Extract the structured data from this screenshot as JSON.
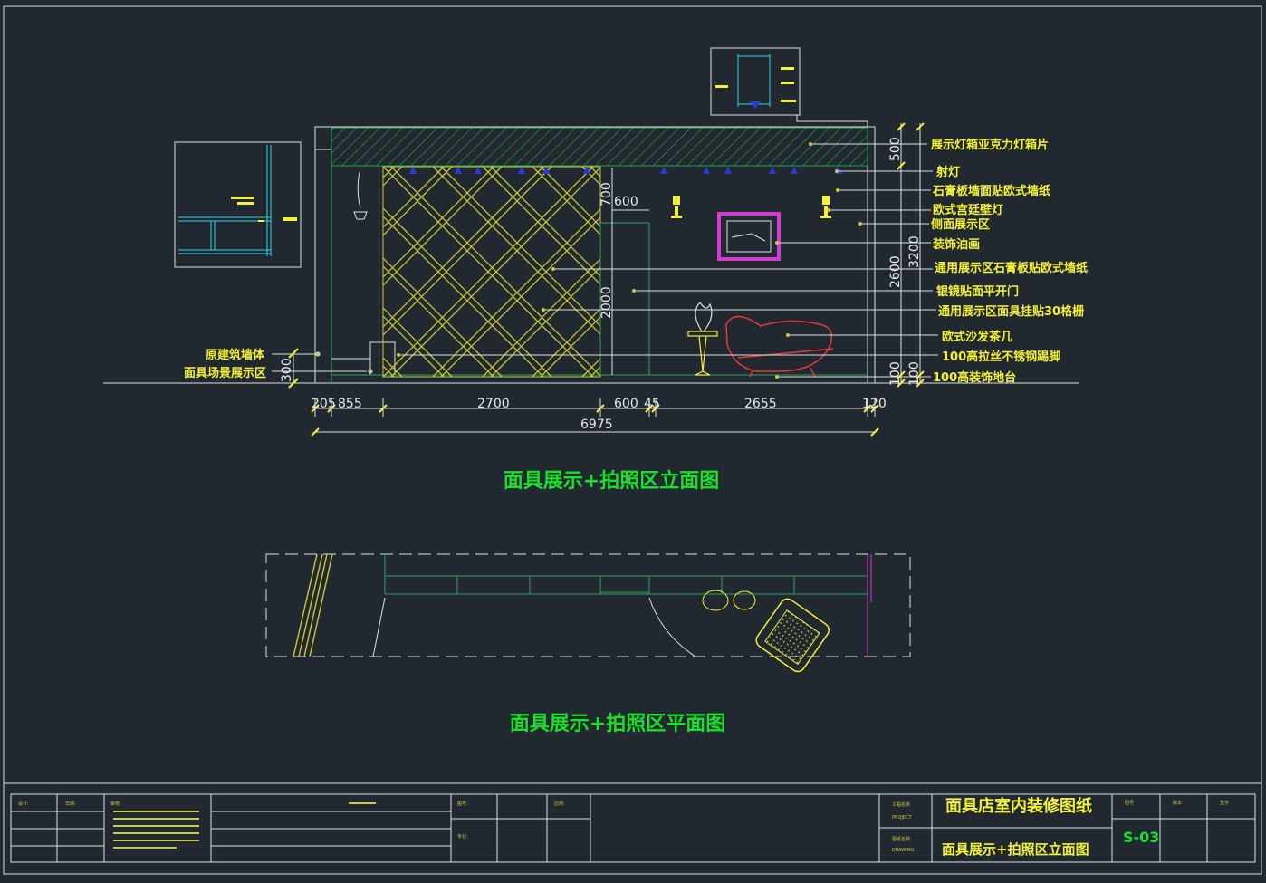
{
  "drawing": {
    "elevation_title": "面具展示+拍照区立面图",
    "plan_title": "面具展示+拍照区平面图",
    "right_labels": [
      "展示灯箱亚克力灯箱片",
      "射灯",
      "石膏板墙面贴欧式墙纸",
      "欧式宫廷壁灯",
      "侧面展示区",
      "装饰油画",
      "通用展示区石膏板贴欧式墙纸",
      "银镜贴面平开门",
      "通用展示区面具挂贴30格栅",
      "欧式沙发茶几",
      "100高拉丝不锈钢踢脚",
      "100高装饰地台"
    ],
    "left_labels": [
      "原建筑墙体",
      "面具场景展示区"
    ],
    "bottom_dims": [
      "205",
      "855",
      "2700",
      "600",
      "45",
      "2655",
      "120"
    ],
    "total_dim": "6975",
    "right_dims": [
      "500",
      "2600",
      "3200",
      "100",
      "100"
    ],
    "left_dim": "300",
    "inner_dims": {
      "door_width": "600",
      "door_top": "700",
      "door_height": "2000"
    }
  },
  "title_block": {
    "project_title": "面具店室内装修图纸",
    "sheet_title": "面具展示+拍照区立面图",
    "sheet_number": "S-03",
    "cells": [
      "设计:",
      "日期:",
      "审核:",
      "图号:",
      "比例:",
      "专业:",
      "工程名称",
      "图纸名称",
      "图号",
      "版本",
      "签字",
      "PROJECT",
      "DRAWING"
    ]
  }
}
